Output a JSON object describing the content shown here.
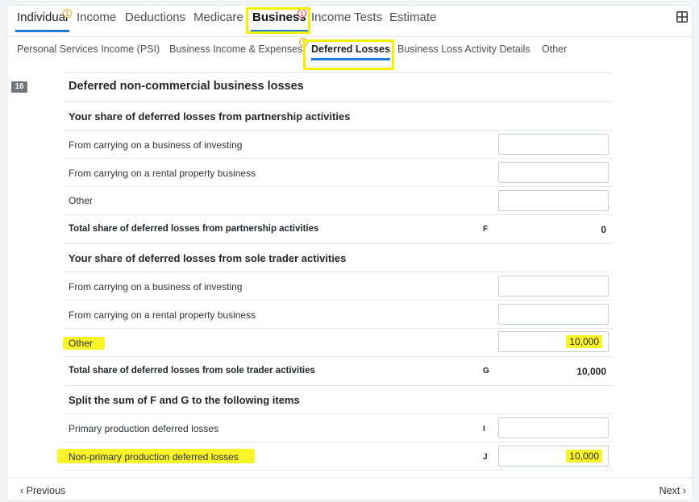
{
  "tabs": [
    "Individual",
    "Income",
    "Deductions",
    "Medicare",
    "Business",
    "Income Tests",
    "Estimate"
  ],
  "tab_badges": {
    "individual": "1",
    "business": "1"
  },
  "subtabs": [
    "Personal Services Income (PSI)",
    "Business Income & Expenses",
    "Deferred Losses",
    "Business Loss Activity Details",
    "Other"
  ],
  "subtab_badge": "1",
  "section_number": "16",
  "form": {
    "title": "Deferred non-commercial business losses",
    "partnership_heading": "Your share of deferred losses from partnership activities",
    "p_investing": "From carrying on a business of investing",
    "p_rental": "From carrying on a rental property business",
    "p_other": "Other",
    "p_total_label": "Total share of deferred losses from partnership activities",
    "p_total_code": "F",
    "p_total_value": "0",
    "sole_heading": "Your share of deferred losses from sole trader activities",
    "s_investing": "From carrying on a business of investing",
    "s_rental": "From carrying on a rental property business",
    "s_other": "Other",
    "s_other_value": "10,000",
    "s_total_label": "Total share of deferred losses from sole trader activities",
    "s_total_code": "G",
    "s_total_value": "10,000",
    "split_heading": "Split the sum of F and G to the following items",
    "primary_label": "Primary production deferred losses",
    "primary_code": "I",
    "primary_value": "",
    "nonprimary_label": "Non-primary production deferred losses",
    "nonprimary_code": "J",
    "nonprimary_value": "10,000"
  },
  "footer": {
    "previous": "‹ Previous",
    "next": "Next ›"
  },
  "colors": {
    "accent": "#1f7bd8",
    "highlight": "#f9f32a",
    "highlight_box": "#f7ef00"
  }
}
